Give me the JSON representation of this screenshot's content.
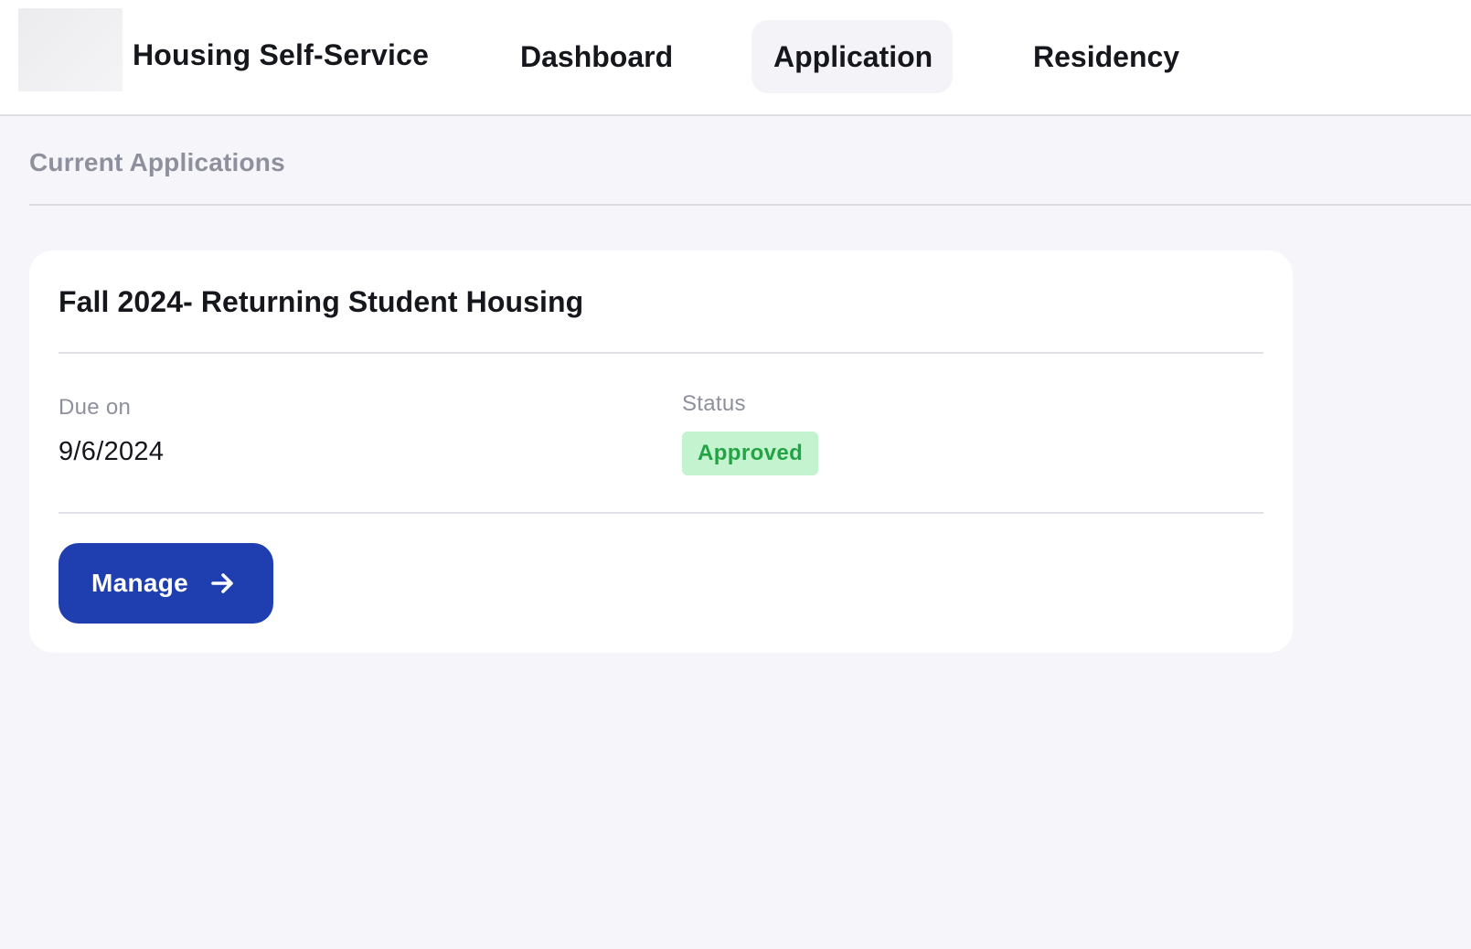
{
  "header": {
    "app_title": "Housing Self-Service",
    "logo_icon": "university-logo-icon",
    "nav": [
      {
        "label": "Dashboard",
        "active": false
      },
      {
        "label": "Application",
        "active": true
      },
      {
        "label": "Residency",
        "active": false
      }
    ]
  },
  "main": {
    "section_title": "Current Applications",
    "applications": [
      {
        "title": "Fall 2024- Returning Student Housing",
        "due_label": "Due on",
        "due_value": "9/6/2024",
        "status_label": "Status",
        "status_value": "Approved",
        "status_color": "#23a344",
        "status_bg": "#c4f3d0",
        "action_label": "Manage",
        "action_icon": "arrow-right-icon"
      }
    ]
  },
  "colors": {
    "primary_button": "#1f3fb0",
    "page_background": "#f5f5fa",
    "card_background": "#ffffff",
    "muted_text": "#8f909d"
  }
}
